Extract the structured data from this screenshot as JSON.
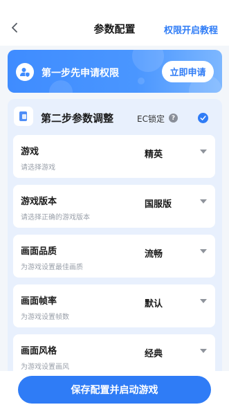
{
  "header": {
    "title": "参数配置",
    "tutorial_link": "权限开启教程"
  },
  "step1": {
    "title": "第一步先申请权限",
    "apply_button": "立即申请"
  },
  "step2": {
    "title": "第二步参数调整",
    "ec_lock_label": "EC锁定",
    "help_glyph": "?",
    "ec_lock_checked": true
  },
  "settings": [
    {
      "name": "游戏",
      "description": "请选择游戏",
      "value": "精英"
    },
    {
      "name": "游戏版本",
      "description": "请选择正确的游戏版本",
      "value": "国服版"
    },
    {
      "name": "画面品质",
      "description": "为游戏设置最佳画质",
      "value": "流畅"
    },
    {
      "name": "画面帧率",
      "description": "为游戏设置帧数",
      "value": "默认"
    },
    {
      "name": "画面风格",
      "description": "为游戏设置画风",
      "value": "经典"
    }
  ],
  "footer": {
    "launch_button": "保存配置并启动游戏"
  },
  "colors": {
    "accent": "#2f7cf6",
    "panel_bg": "#e8f0fd",
    "page_bg": "#f3f6fa"
  },
  "icons": {
    "back": "chevron-left-icon",
    "user_shield": "user-shield-icon",
    "document": "document-icon",
    "help": "help-icon",
    "check": "check-icon",
    "dropdown": "caret-down-icon"
  }
}
